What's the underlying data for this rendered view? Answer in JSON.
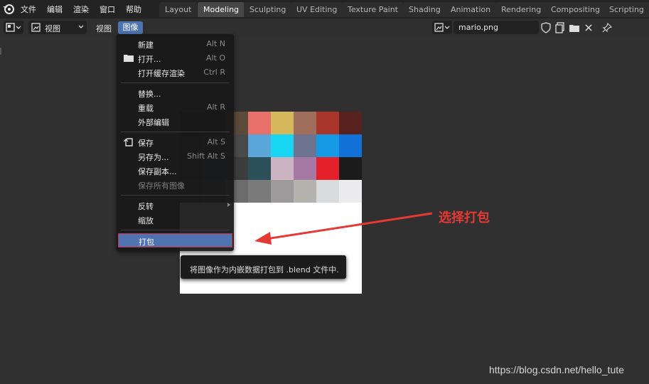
{
  "topbar": {
    "menus": [
      "文件",
      "编辑",
      "渲染",
      "窗口",
      "帮助"
    ],
    "workspaces": [
      "Layout",
      "Modeling",
      "Sculpting",
      "UV Editing",
      "Texture Paint",
      "Shading",
      "Animation",
      "Rendering",
      "Compositing",
      "Scripting"
    ],
    "active_workspace": "Modeling"
  },
  "header": {
    "mode": "视图",
    "view_menu": "视图",
    "image_menu": "图像",
    "image_name": "mario.png"
  },
  "image_menu": {
    "items": [
      {
        "label": "新建",
        "shortcut": "Alt N"
      },
      {
        "label": "打开...",
        "shortcut": "Alt O",
        "icon": "folder-icon"
      },
      {
        "label": "打开缓存渲染",
        "shortcut": "Ctrl R"
      },
      {
        "label": "替换...",
        "shortcut": ""
      },
      {
        "label": "重载",
        "shortcut": "Alt R"
      },
      {
        "label": "外部编辑",
        "shortcut": ""
      },
      {
        "label": "保存",
        "shortcut": "Alt S",
        "icon": "save-icon"
      },
      {
        "label": "另存为...",
        "shortcut": "Shift Alt S"
      },
      {
        "label": "保存副本...",
        "shortcut": ""
      },
      {
        "label": "保存所有图像",
        "shortcut": "",
        "disabled": true
      },
      {
        "label": "反转",
        "shortcut": "",
        "submenu": true
      },
      {
        "label": "缩放",
        "shortcut": ""
      },
      {
        "label": "打包",
        "shortcut": "",
        "selected": true
      }
    ]
  },
  "tooltip": "将图像作为内嵌数据打包到 .blend 文件中.",
  "annotation": "选择打包",
  "watermark": "https://blog.csdn.net/hello_tute",
  "colors": {
    "accent": "#4f72b0",
    "highlight_border": "#d02d3a",
    "annotation": "#e53935",
    "palette_rows": [
      [
        "#1f1f1f",
        "#2c1f18",
        "#5a4a3a",
        "#e8706a",
        "#d6b85c",
        "#9f6e5c",
        "#a8362a",
        "#5a221e",
        "#3ec43a"
      ],
      [
        "#2b2b2b",
        "#3a3a3a",
        "#4a4a4a",
        "#5aa6d8",
        "#18d6f2",
        "#6e7490",
        "#169ae6",
        "#1271d6",
        "#1a44b8"
      ],
      [
        "#242424",
        "#2e3a4a",
        "#3c3c3c",
        "#2c5058",
        "#cbb3c1",
        "#a678a4",
        "#e4202a",
        "#1c1c1c",
        "#2c2c2e"
      ],
      [
        "#353535",
        "#474747",
        "#6c6c6c",
        "#7a7a7a",
        "#9c9a9a",
        "#b6b2ae",
        "#d8dcdc",
        "#ececee",
        "#fbfbfb"
      ]
    ]
  }
}
